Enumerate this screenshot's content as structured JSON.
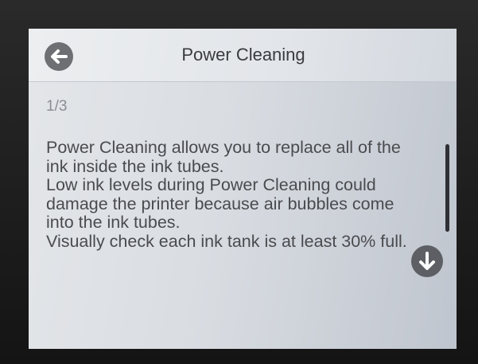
{
  "header": {
    "title": "Power Cleaning",
    "back_icon": "arrow-left-circle-icon"
  },
  "page_indicator": "1/3",
  "body": {
    "paragraphs": [
      "Power Cleaning allows you to replace all of the ink inside the ink tubes.",
      "Low ink levels during Power Cleaning could damage the printer because air bubbles come into the ink tubes.",
      "Visually check each ink tank is at least 30% full."
    ]
  },
  "scroll": {
    "down_icon": "arrow-down-circle-icon"
  },
  "colors": {
    "button_fill": "#6e6f72",
    "text": "#4a4b4e",
    "scrollbar": "#2e3035"
  }
}
